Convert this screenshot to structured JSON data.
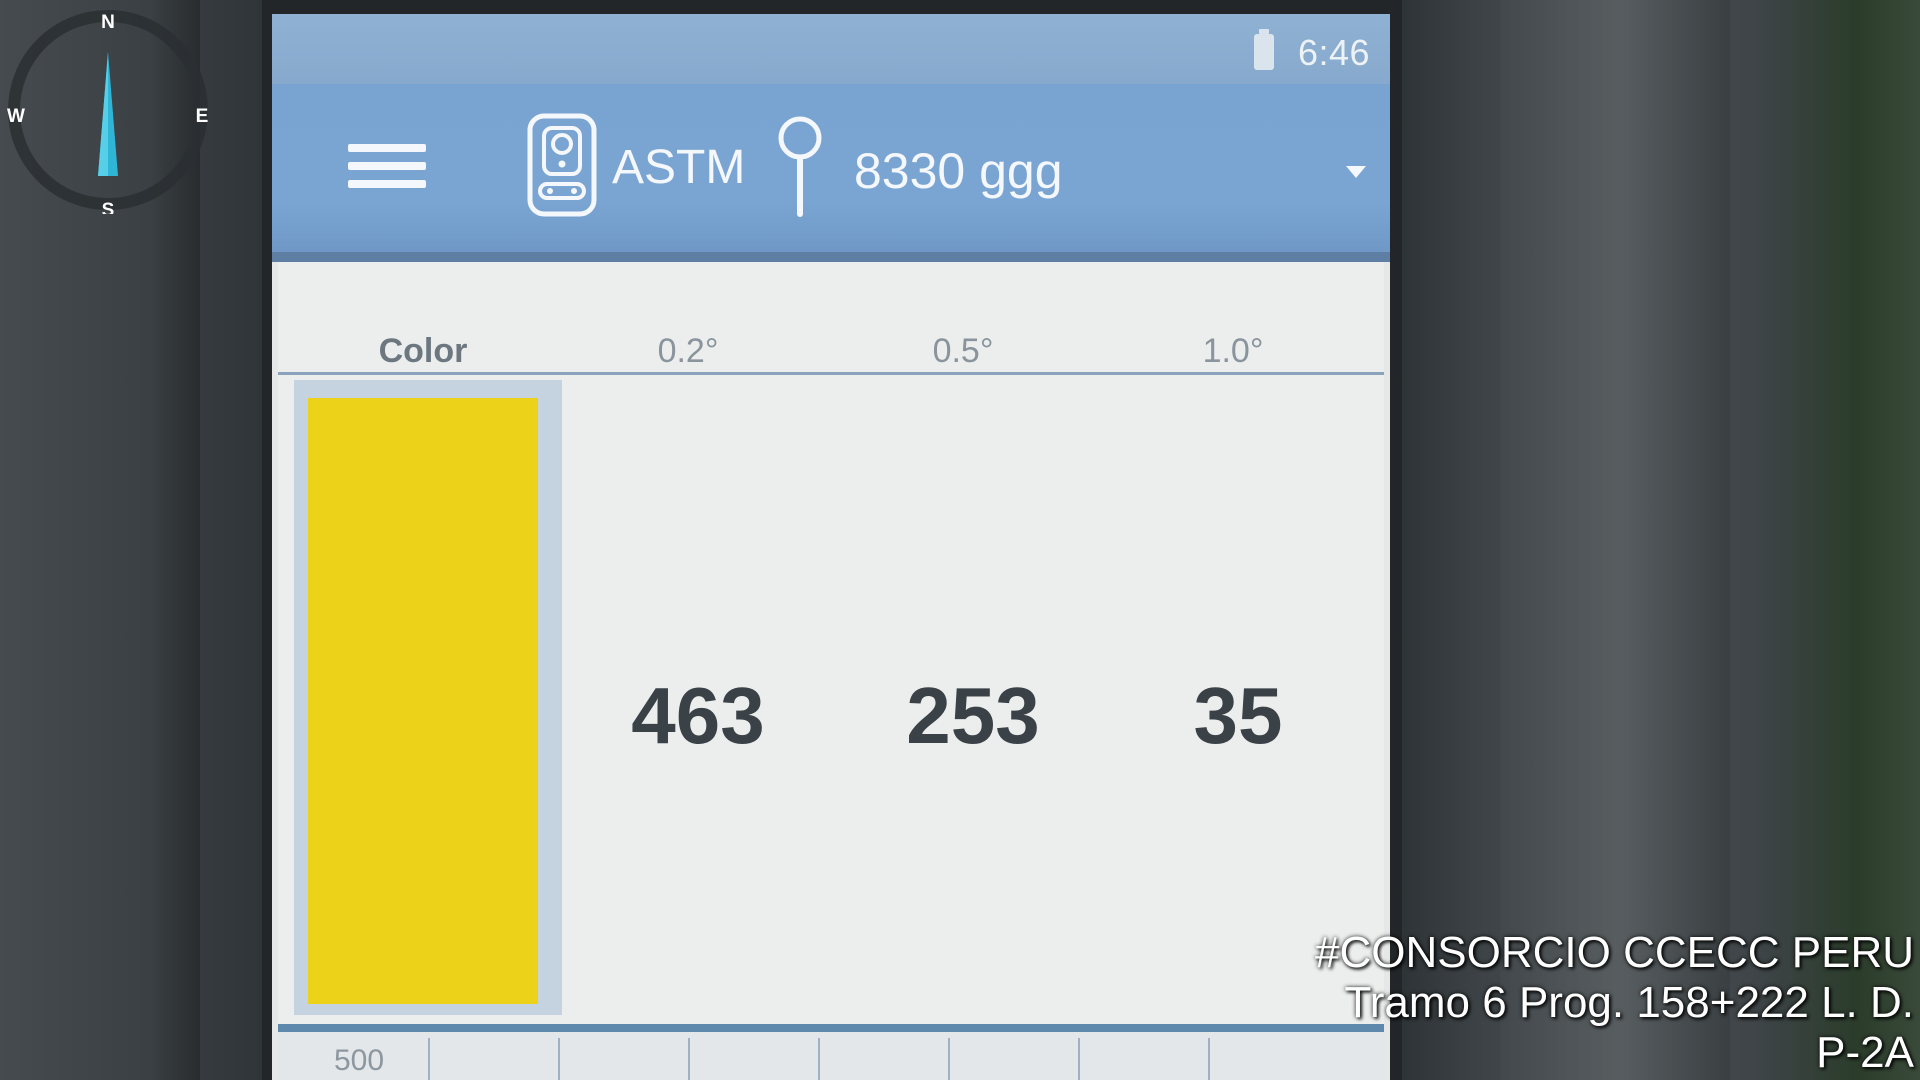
{
  "status_bar": {
    "time": "6:46",
    "battery_icon": "battery-icon"
  },
  "app_bar": {
    "menu_icon": "hamburger-menu-icon",
    "instrument_icon": "retroreflectometer-icon",
    "standard": "ASTM",
    "location_icon": "location-pin-icon",
    "profile": "8330 ggg",
    "dropdown_icon": "chevron-down-icon"
  },
  "table": {
    "headers": [
      "Color",
      "0.2°",
      "0.5°",
      "1.0°"
    ],
    "color_swatch": "#ecd31a",
    "values": [
      "463",
      "253",
      "35"
    ]
  },
  "chart_strip": {
    "axis_label": "500"
  },
  "compass": {
    "north": "N",
    "south": "S",
    "east": "E",
    "west": "W"
  },
  "watermark": {
    "line1": "#CONSORCIO CCECC PERU",
    "line2": "Tramo 6 Prog. 158+222 L. D.",
    "line3": "P-2A"
  },
  "colors": {
    "app_bar": "#79a3d1",
    "accent": "#5f88ad"
  }
}
